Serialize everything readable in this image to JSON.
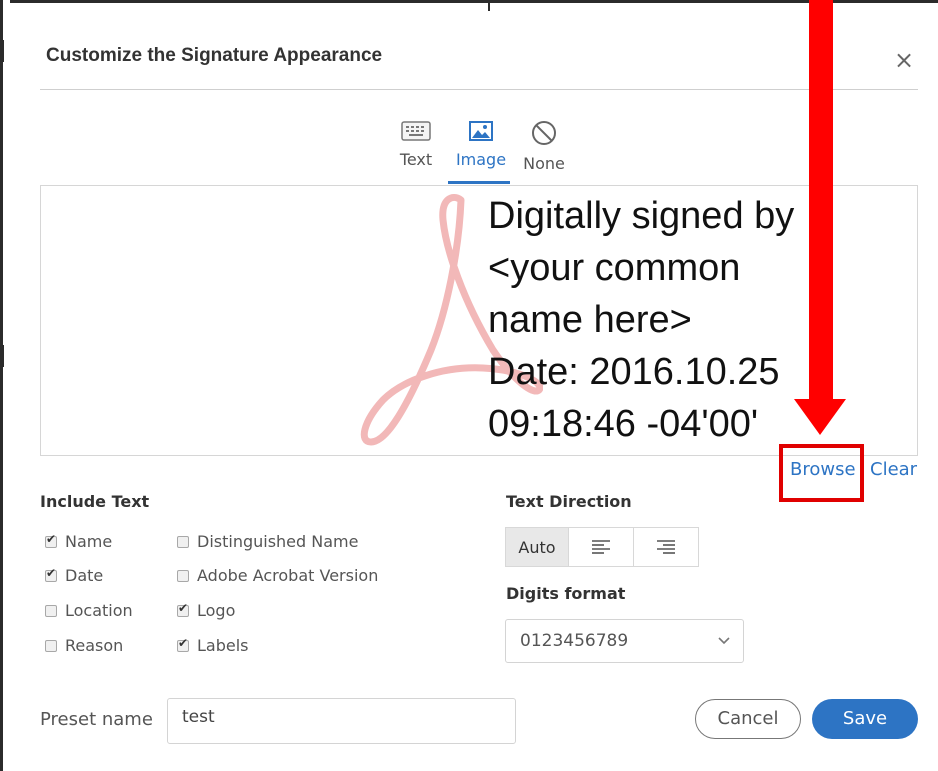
{
  "dialog": {
    "title": "Customize the Signature Appearance",
    "close_icon": "close-icon"
  },
  "tabs": [
    {
      "label": "Text",
      "icon": "keyboard-icon",
      "selected": false
    },
    {
      "label": "Image",
      "icon": "image-icon",
      "selected": true
    },
    {
      "label": "None",
      "icon": "no-entry-icon",
      "selected": false
    }
  ],
  "preview": {
    "lines": [
      "Digitally signed by",
      "<your common",
      "name here>",
      "Date: 2016.10.25",
      "09:18:46 -04'00'"
    ],
    "watermark_icon": "acrobat-logo-watermark"
  },
  "image_actions": {
    "browse": "Browse",
    "clear": "Clear"
  },
  "include_text": {
    "label": "Include Text",
    "options": [
      {
        "label": "Name",
        "checked": true
      },
      {
        "label": "Date",
        "checked": true
      },
      {
        "label": "Location",
        "checked": false
      },
      {
        "label": "Reason",
        "checked": false
      },
      {
        "label": "Distinguished Name",
        "checked": false
      },
      {
        "label": "Adobe Acrobat Version",
        "checked": false
      },
      {
        "label": "Logo",
        "checked": true
      },
      {
        "label": "Labels",
        "checked": true
      }
    ]
  },
  "text_direction": {
    "label": "Text Direction",
    "options": [
      {
        "label": "Auto",
        "selected": true
      },
      {
        "icon": "align-left-icon",
        "selected": false
      },
      {
        "icon": "align-right-icon",
        "selected": false
      }
    ]
  },
  "digits_format": {
    "label": "Digits format",
    "value": "0123456789"
  },
  "preset": {
    "label": "Preset name",
    "value": "test"
  },
  "buttons": {
    "cancel": "Cancel",
    "save": "Save"
  },
  "annotation": {
    "arrow_color": "#ff0000",
    "highlight_color": "#e00000"
  },
  "colors": {
    "accent": "#2d74c4"
  }
}
